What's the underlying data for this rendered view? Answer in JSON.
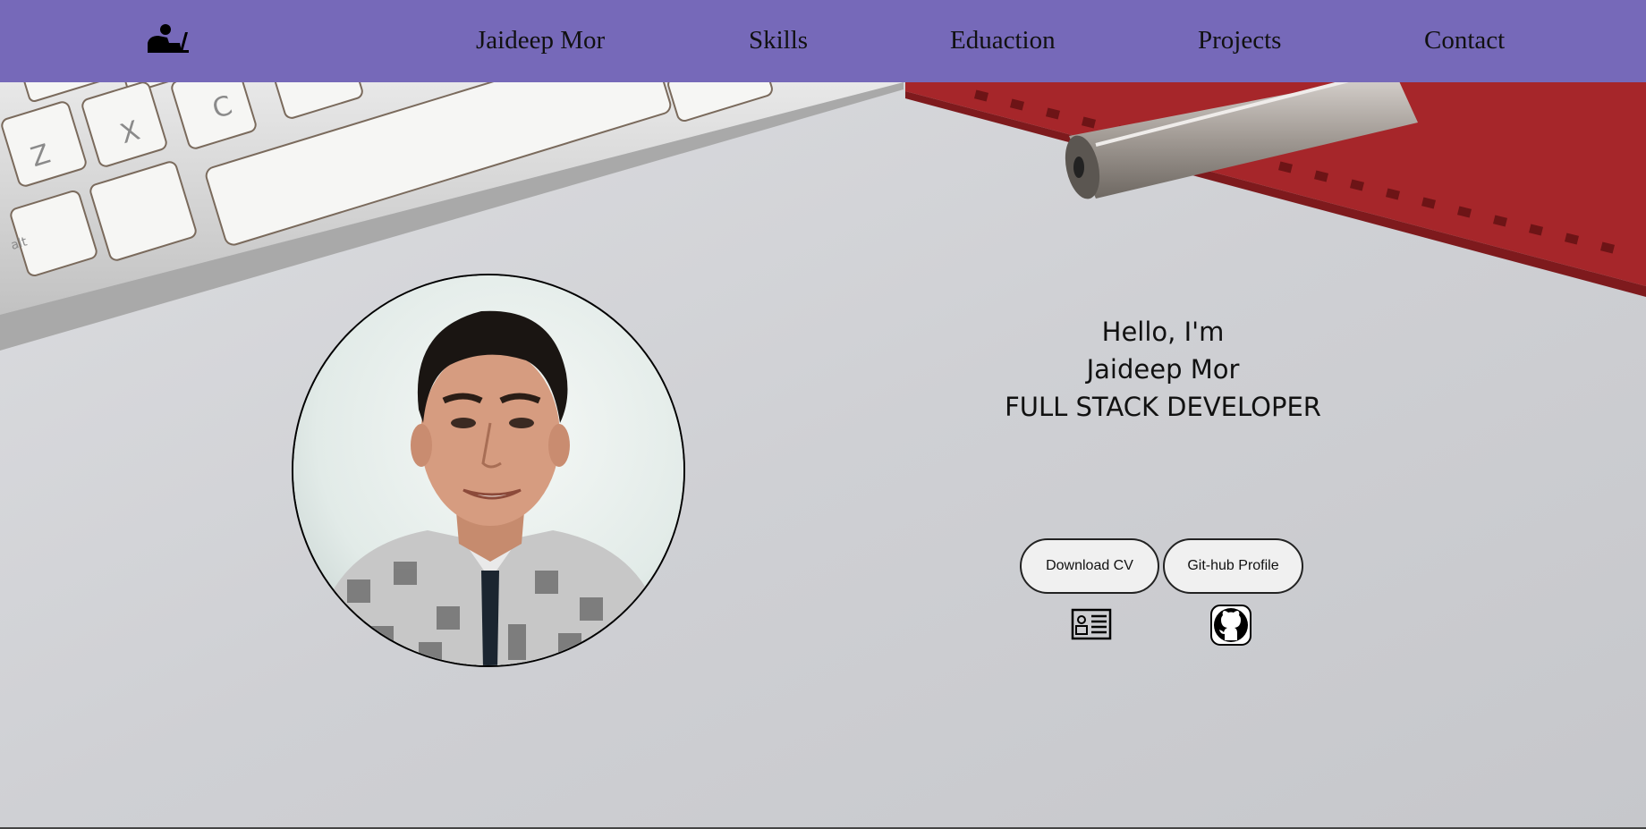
{
  "nav": {
    "logo_icon": "person-laptop-icon",
    "links": [
      {
        "label": "Jaideep Mor"
      },
      {
        "label": "Skills"
      },
      {
        "label": "Eduaction"
      },
      {
        "label": "Projects"
      },
      {
        "label": "Contact"
      }
    ],
    "background_color": "#7669b9"
  },
  "hero": {
    "greeting": "Hello, I'm",
    "name": "Jaideep Mor",
    "role": "FULL STACK DEVELOPER",
    "buttons": {
      "download_cv": "Download CV",
      "github_profile": "Git-hub Profile"
    },
    "icons": {
      "cv": "id-card-icon",
      "github": "github-icon"
    }
  }
}
